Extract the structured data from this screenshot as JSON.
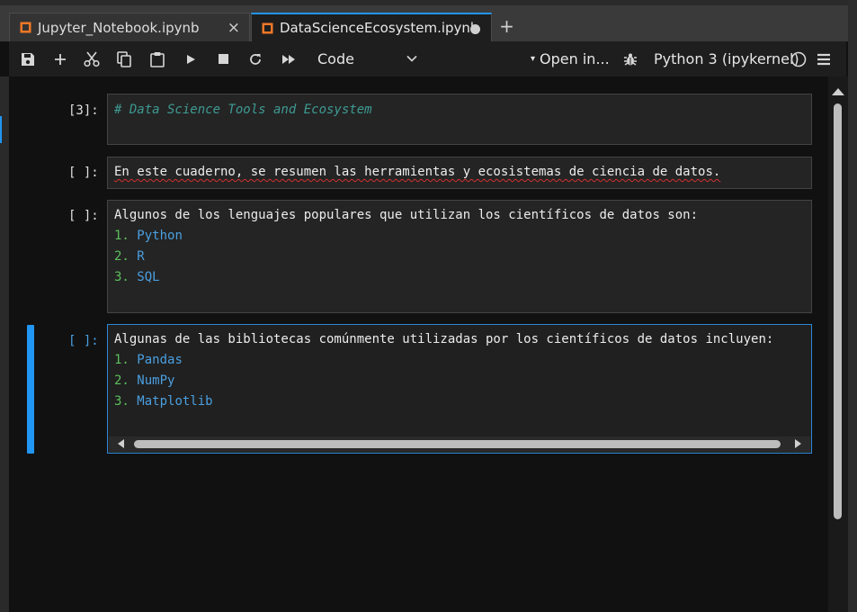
{
  "tabs": [
    {
      "label": "Jupyter_Notebook.ipynb",
      "close_glyph": "×"
    },
    {
      "label": "DataScienceEcosystem.ipynb",
      "active": true
    }
  ],
  "new_tab_glyph": "+",
  "toolbar": {
    "cell_type": "Code",
    "open_in": "Open in...",
    "open_in_caret": "▾",
    "kernel_name": "Python 3 (ipykernel)"
  },
  "cells": [
    {
      "prompt": "[3]:",
      "lines": [
        "# Data Science Tools and Ecosystem"
      ]
    },
    {
      "prompt": "[ ]:",
      "lines": [
        "En este cuaderno, se resumen las herramientas y ecosistemas de ciencia de datos."
      ]
    },
    {
      "prompt": "[ ]:",
      "heading": "Algunos de los lenguajes populares que utilizan los científicos de datos son:",
      "items": [
        {
          "num": "1.",
          "text": "Python"
        },
        {
          "num": "2.",
          "text": "R"
        },
        {
          "num": "3.",
          "text": "SQL"
        }
      ]
    },
    {
      "prompt": "[ ]:",
      "heading": "Algunas de las bibliotecas comúnmente utilizadas por los científicos de datos incluyen:",
      "items": [
        {
          "num": "1.",
          "text": "Pandas"
        },
        {
          "num": "2.",
          "text": "NumPy"
        },
        {
          "num": "3.",
          "text": "Matplotlib"
        }
      ]
    }
  ],
  "colors": {
    "accent": "#2196f3",
    "comment": "#3e9a93",
    "list_number": "#5cbf5c",
    "list_text": "#4a9fe0"
  }
}
